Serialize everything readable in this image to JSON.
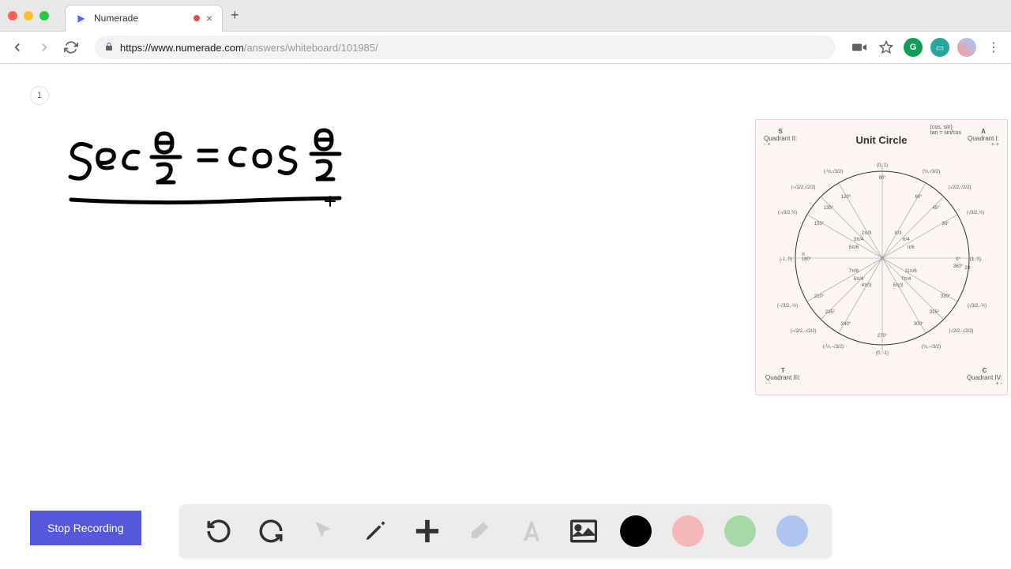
{
  "browser": {
    "tab_title": "Numerade",
    "url_host": "https://www.numerade.com",
    "url_path": "/answers/whiteboard/101985/"
  },
  "page": {
    "badge": "1"
  },
  "unit_circle": {
    "title": "Unit Circle",
    "q1_letter": "A",
    "q1_label": "Quadrant I:",
    "q2_letter": "S",
    "q2_label": "Quadrant II:",
    "q3_letter": "T",
    "q3_label": "Quadrant III:",
    "q4_letter": "C",
    "q4_label": "Quadrant IV:",
    "rule_top": "(cos, sin)",
    "rule_bottom": "tan = sin/cos"
  },
  "buttons": {
    "stop_recording": "Stop Recording"
  },
  "colors": {
    "accent": "#5558da",
    "black": "#000000",
    "pink": "#f4b8b8",
    "green": "#a8d8a8",
    "blue": "#b0c4f0"
  },
  "equation": {
    "text": "sec θ/2 = cos θ/2"
  }
}
